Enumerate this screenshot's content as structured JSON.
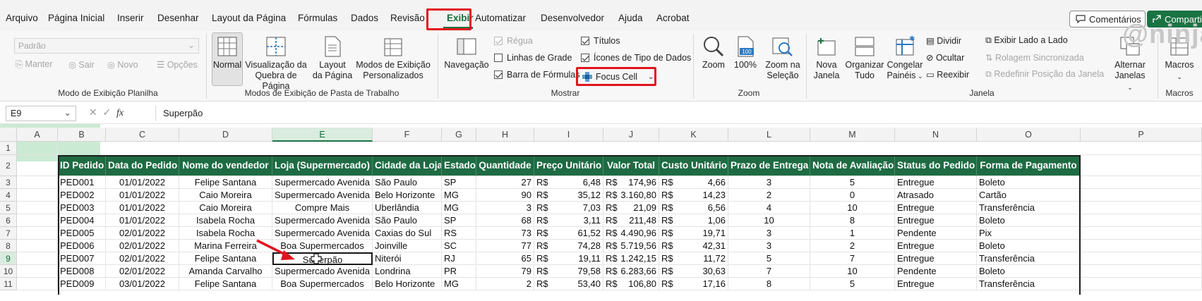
{
  "menu": {
    "tabs": [
      "Arquivo",
      "Página Inicial",
      "Inserir",
      "Desenhar",
      "Layout da Página",
      "Fórmulas",
      "Dados",
      "Revisão",
      "Exibir",
      "Automatizar",
      "Desenvolvedor",
      "Ajuda",
      "Acrobat"
    ],
    "active_tab": "Exibir",
    "comments_label": "Comentários",
    "share_label": "Compartil",
    "watermark": "@ninja"
  },
  "ribbon": {
    "sheet_view": {
      "combo_value": "Padrão",
      "keep": "Manter",
      "exit": "Sair",
      "new": "Novo",
      "options": "Opções",
      "group_label": "Modo de Exibição Planilha"
    },
    "workbook_views": {
      "normal": "Normal",
      "page_break": [
        "Visualização da",
        "Quebra de Página"
      ],
      "page_layout": [
        "Layout",
        "da Página"
      ],
      "custom": [
        "Modos de Exibição",
        "Personalizados"
      ],
      "group_label": "Modos de Exibição de Pasta de Trabalho"
    },
    "show": {
      "navigation": "Navegação",
      "ruler": "Régua",
      "gridlines": "Linhas de Grade",
      "formula_bar": "Barra de Fórmulas",
      "titles": "Títulos",
      "data_type_icons": "Ícones de Tipo de Dados",
      "focus_cell": "Focus Cell",
      "group_label": "Mostrar",
      "ruler_checked": true,
      "gridlines_checked": false,
      "formula_bar_checked": true,
      "titles_checked": true,
      "data_type_icons_checked": true
    },
    "zoom": {
      "zoom": "Zoom",
      "hundred": "100%",
      "selection": [
        "Zoom na",
        "Seleção"
      ],
      "group_label": "Zoom"
    },
    "window": {
      "new_window": [
        "Nova",
        "Janela"
      ],
      "arrange_all": [
        "Organizar",
        "Tudo"
      ],
      "freeze_panes": [
        "Congelar",
        "Painéis"
      ],
      "split": "Dividir",
      "hide": "Ocultar",
      "unhide": "Reexibir",
      "side_by_side": "Exibir Lado a Lado",
      "sync_scroll": "Rolagem Sincronizada",
      "reset_position": "Redefinir Posição da Janela",
      "switch_windows": [
        "Alternar",
        "Janelas"
      ],
      "group_label": "Janela"
    },
    "macros": {
      "label": "Macros",
      "group_label": "Macros"
    }
  },
  "formula_bar": {
    "name_box": "E9",
    "formula": "Superpão"
  },
  "grid": {
    "columns": [
      "A",
      "B",
      "C",
      "D",
      "E",
      "F",
      "G",
      "H",
      "I",
      "J",
      "K",
      "L",
      "M",
      "N",
      "O",
      "P"
    ],
    "selected_column": "E",
    "rows": [
      "1",
      "2",
      "3",
      "4",
      "5",
      "6",
      "7",
      "8",
      "9",
      "10",
      "11"
    ],
    "selected_row": "9",
    "headers": [
      "ID Pedido",
      "Data do Pedido",
      "Nome do vendedor",
      "Loja (Supermercado)",
      "Cidade da Loja",
      "Estado",
      "Quantidade",
      "Preço Unitário",
      "Valor Total",
      "Custo Unitário",
      "Prazo de Entrega",
      "Nota de Avaliação",
      "Status do Pedido",
      "Forma de Pagamento"
    ],
    "data": [
      [
        "PED001",
        "01/01/2022",
        "Felipe Santana",
        "Supermercado Avenida",
        "São Paulo",
        "SP",
        "27",
        "R$",
        "6,48",
        "R$",
        "174,96",
        "R$",
        "4,66",
        "3",
        "5",
        "Entregue",
        "Boleto"
      ],
      [
        "PED002",
        "01/01/2022",
        "Caio Moreira",
        "Supermercado Avenida",
        "Belo Horizonte",
        "MG",
        "90",
        "R$",
        "35,12",
        "R$",
        "3.160,80",
        "R$",
        "14,23",
        "2",
        "0",
        "Atrasado",
        "Cartão"
      ],
      [
        "PED003",
        "01/01/2022",
        "Caio Moreira",
        "Compre Mais",
        "Uberlândia",
        "MG",
        "3",
        "R$",
        "7,03",
        "R$",
        "21,09",
        "R$",
        "6,56",
        "4",
        "10",
        "Entregue",
        "Transferência"
      ],
      [
        "PED004",
        "01/01/2022",
        "Isabela Rocha",
        "Supermercado Avenida",
        "São Paulo",
        "SP",
        "68",
        "R$",
        "3,11",
        "R$",
        "211,48",
        "R$",
        "1,06",
        "10",
        "8",
        "Entregue",
        "Boleto"
      ],
      [
        "PED005",
        "02/01/2022",
        "Isabela Rocha",
        "Supermercado Avenida",
        "Caxias do Sul",
        "RS",
        "73",
        "R$",
        "61,52",
        "R$",
        "4.490,96",
        "R$",
        "19,71",
        "3",
        "1",
        "Pendente",
        "Pix"
      ],
      [
        "PED006",
        "02/01/2022",
        "Marina Ferreira",
        "Boa Supermercados",
        "Joinville",
        "SC",
        "77",
        "R$",
        "74,28",
        "R$",
        "5.719,56",
        "R$",
        "42,31",
        "3",
        "2",
        "Entregue",
        "Boleto"
      ],
      [
        "PED007",
        "02/01/2022",
        "Felipe Santana",
        "Superpão",
        "Niterói",
        "RJ",
        "65",
        "R$",
        "19,11",
        "R$",
        "1.242,15",
        "R$",
        "11,72",
        "5",
        "7",
        "Entregue",
        "Transferência"
      ],
      [
        "PED008",
        "02/01/2022",
        "Amanda Carvalho",
        "Supermercado Avenida",
        "Londrina",
        "PR",
        "79",
        "R$",
        "79,58",
        "R$",
        "6.283,66",
        "R$",
        "30,63",
        "7",
        "10",
        "Pendente",
        "Boleto"
      ],
      [
        "PED009",
        "03/01/2022",
        "Felipe Santana",
        "Boa Supermercados",
        "Belo Horizonte",
        "MG",
        "2",
        "R$",
        "53,40",
        "R$",
        "106,80",
        "R$",
        "17,16",
        "8",
        "5",
        "Entregue",
        "Transferência"
      ]
    ]
  }
}
